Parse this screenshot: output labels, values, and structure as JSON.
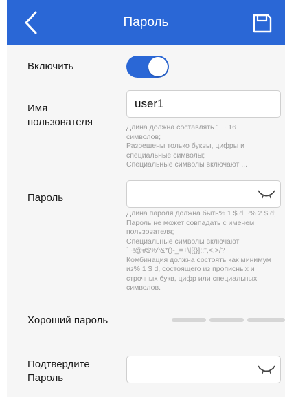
{
  "header": {
    "title": "Пароль",
    "back_icon": "chevron-left-icon",
    "save_icon": "save-icon"
  },
  "enable": {
    "label": "Включить",
    "toggle_on": true
  },
  "username": {
    "label_line1": "Имя",
    "label_line2": "пользователя",
    "value": "user1",
    "hint": [
      "Длина должна составлять 1 ~ 16",
      "символов;",
      "Разрешены только буквы, цифры и",
      "специальные символы;",
      "Специальные символы включают ..."
    ]
  },
  "password": {
    "label": "Пароль",
    "value": "",
    "hint": [
      "Длина пароля должна быть% 1 $ d ~% 2 $ d;",
      "Пароль не может совпадать с именем",
      "пользователя;",
      "Специальные символы включают",
      "`~!@#$%^&*()-_=+\\|[{}];:\",<.>/?",
      "Комбинация должна состоять как минимум",
      "из% 1 $ d, состоящего из прописных и",
      "строчных букв, цифр или специальных",
      "символов."
    ]
  },
  "strength": {
    "label": "Хороший пароль",
    "segments": 3,
    "level": 0
  },
  "confirm": {
    "label_line1": "Подтвердите",
    "label_line2": "Пароль",
    "value": ""
  },
  "colors": {
    "accent": "#2a67d6",
    "background": "#f6f6f6",
    "hint": "#9a9a9a",
    "strength_empty": "#d6d6d6"
  }
}
